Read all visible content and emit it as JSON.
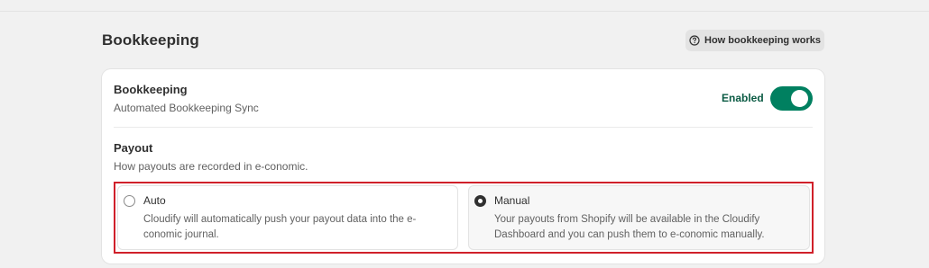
{
  "page": {
    "title": "Bookkeeping",
    "help_button_label": "How bookkeeping works",
    "help_icon": "question-circle-icon"
  },
  "bookkeeping": {
    "title": "Bookkeeping",
    "subtitle": "Automated Bookkeeping Sync",
    "status_label": "Enabled",
    "enabled": true
  },
  "payout": {
    "title": "Payout",
    "subtitle": "How payouts are recorded in e-conomic.",
    "options": [
      {
        "label": "Auto",
        "description": "Cloudify will automatically push your payout data into the e-conomic journal.",
        "selected": false
      },
      {
        "label": "Manual",
        "description": "Your payouts from Shopify will be available in the Cloudify Dashboard and you can push them to e-conomic manually.",
        "selected": true
      }
    ]
  },
  "colors": {
    "toggle_on": "#008060",
    "status_text": "#0b5b44",
    "highlight_border": "#d0202a",
    "background": "#f1f1f1"
  }
}
